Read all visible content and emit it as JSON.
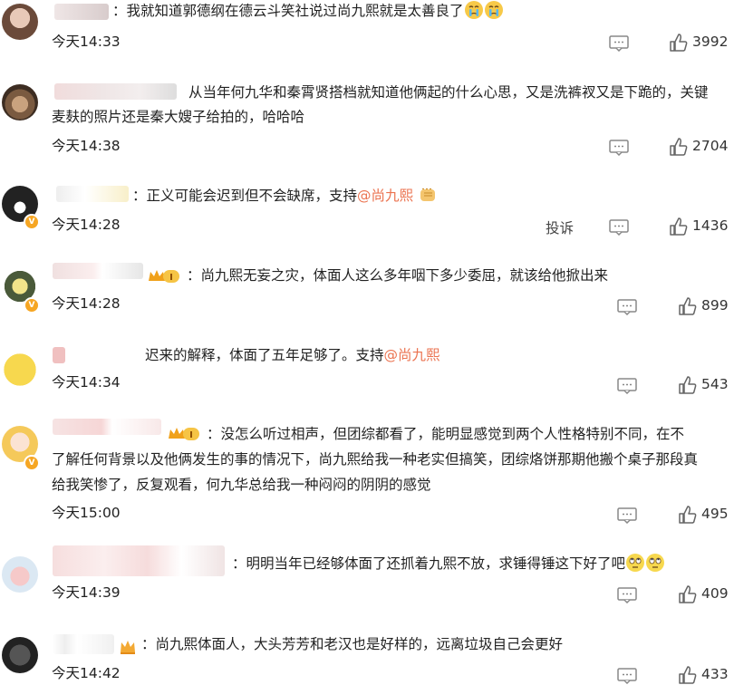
{
  "comments": [
    {
      "name": "",
      "text": "我就知道郭德纲在德云斗笑社说过尚九熙就是太善良了",
      "time": "今天14:33",
      "likes": "3992",
      "emoji": "crying-face-icon"
    },
    {
      "name": "",
      "text": "从当年何九华和秦霄贤搭档就知道他俩起的什么心思，又是洗裤衩又是下跪的，关键",
      "text2": "麦麸的照片还是秦大嫂子给拍的，哈哈哈",
      "time": "今天14:38",
      "likes": "2704"
    },
    {
      "name": "",
      "text": "：正义可能会迟到但不会缺席，支持",
      "mention": "@尚九熙",
      "time": "今天14:28",
      "report": "投诉",
      "likes": "1436"
    },
    {
      "name": "",
      "badge": "I",
      "text": "：尚九熙无妄之灾，体面人这么多年咽下多少委屈，就该给他掀出来",
      "time": "今天14:28",
      "likes": "899"
    },
    {
      "name": "",
      "text": "迟来的解释，体面了五年足够了。支持",
      "mention": "@尚九熙",
      "time": "今天14:34",
      "likes": "543"
    },
    {
      "name": "",
      "badge": "I",
      "text": "：没怎么听过相声，但团综都看了，能明显感觉到两个人性格特别不同，在不",
      "text2": "了解任何背景以及他俩发生的事的情况下，尚九熙给我一种老实但搞笑，团综烙饼那期他搬个桌子那段真",
      "text3": "给我笑惨了，反复观看，何九华总给我一种闷闷的阴阴的感觉",
      "time": "今天15:00",
      "likes": "495"
    },
    {
      "name": "",
      "text": "：明明当年已经够体面了还抓着九熙不放，求锤得锤这下好了吧",
      "time": "今天14:39",
      "likes": "409"
    },
    {
      "name": "",
      "text": "：尚九熙体面人，大头芳芳和老汉也是好样的，远离垃圾自己会更好",
      "time": "今天14:42",
      "likes": "433"
    }
  ],
  "colors": {
    "accent": "#eb7350",
    "text": "#222222",
    "icon": "#888888"
  }
}
